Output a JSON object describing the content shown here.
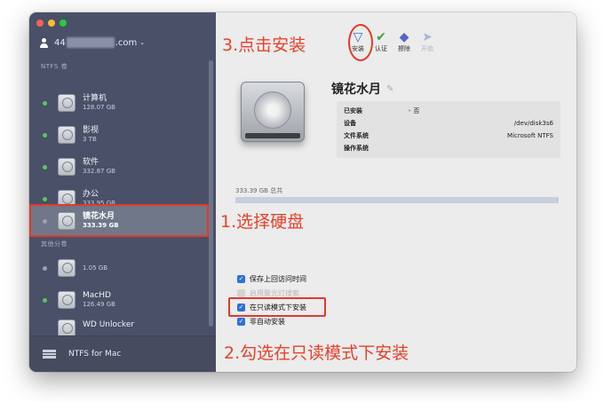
{
  "window": {
    "account_prefix": "44",
    "account_suffix": ".com",
    "sections": {
      "ntfs": "NTFS 卷",
      "other": "其他分卷"
    },
    "ntfs_drives": [
      {
        "name": "计算机",
        "size": "128.07 GB",
        "mounted": true
      },
      {
        "name": "影视",
        "size": "3 TB",
        "mounted": true
      },
      {
        "name": "软件",
        "size": "332.87 GB",
        "mounted": true
      },
      {
        "name": "办公",
        "size": "333.95 GB",
        "mounted": true
      },
      {
        "name": "镜花水月",
        "size": "333.39 GB",
        "mounted": false,
        "selected": true
      }
    ],
    "other_drives": [
      {
        "name": "",
        "size": "1.05 GB",
        "mounted": false
      },
      {
        "name": "MacHD",
        "size": "126.49 GB",
        "mounted": true
      },
      {
        "name": "WD Unlocker",
        "size": "",
        "mounted": false
      }
    ],
    "footer_label": "NTFS for Mac"
  },
  "toolbar": {
    "install": "安装",
    "verify": "认证",
    "erase": "擦除",
    "start": "开始"
  },
  "detail": {
    "title": "镜花水月",
    "info": [
      {
        "key": "已安装",
        "value": "否"
      },
      {
        "key": "设备",
        "value": "/dev/disk3s6"
      },
      {
        "key": "文件系统",
        "value": "Microsoft NTFS"
      },
      {
        "key": "操作系统",
        "value": ""
      }
    ],
    "capacity": "333.39 GB 总共",
    "options": [
      {
        "label": "保存上回访问时间",
        "checked": true,
        "enabled": true
      },
      {
        "label": "启用聚光灯搜索",
        "checked": false,
        "enabled": false
      },
      {
        "label": "在只读模式下安装",
        "checked": true,
        "enabled": true
      },
      {
        "label": "非自动安装",
        "checked": true,
        "enabled": true
      }
    ]
  },
  "annotations": {
    "step1": "1.选择硬盘",
    "step2": "2.勾选在只读模式下安装",
    "step3": "3.点击安装"
  },
  "colors": {
    "sidebar": "#4a5068",
    "annotation": "#e8412a",
    "accent": "#2f6fe0"
  }
}
